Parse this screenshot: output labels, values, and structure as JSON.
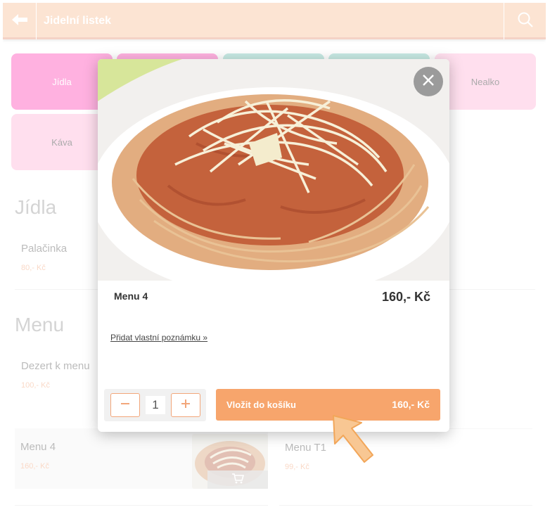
{
  "header": {
    "title": "Jidelní listek",
    "back_icon": "back-arrow-icon",
    "search_icon": "search-icon"
  },
  "categories": [
    "Jídla",
    "",
    "",
    "",
    "Nealko",
    "Káva"
  ],
  "sections": [
    {
      "title": "Jídla",
      "items": [
        {
          "name": "Palačinka",
          "price": "80,- Kč"
        }
      ]
    },
    {
      "title": "Menu",
      "items": [
        {
          "name": "Dezert k menu",
          "price": "100,- Kč"
        }
      ]
    }
  ],
  "cards": [
    {
      "name": "Menu 4",
      "price": "160,- Kč"
    },
    {
      "name": "Menu T1",
      "price": "99,- Kč"
    }
  ],
  "modal": {
    "product_name": "Menu 4",
    "product_price": "160,- Kč",
    "note_link": "Přidat vlastní poznámku »",
    "quantity": "1",
    "add_label": "Vložit do košíku",
    "add_price": "160,- Kč"
  },
  "colors": {
    "header": "#f9c9a6",
    "accent": "#f7a56c",
    "pink": "#ff63c0",
    "teal": "#8fd3c6",
    "light_pink": "#ffbedd"
  }
}
